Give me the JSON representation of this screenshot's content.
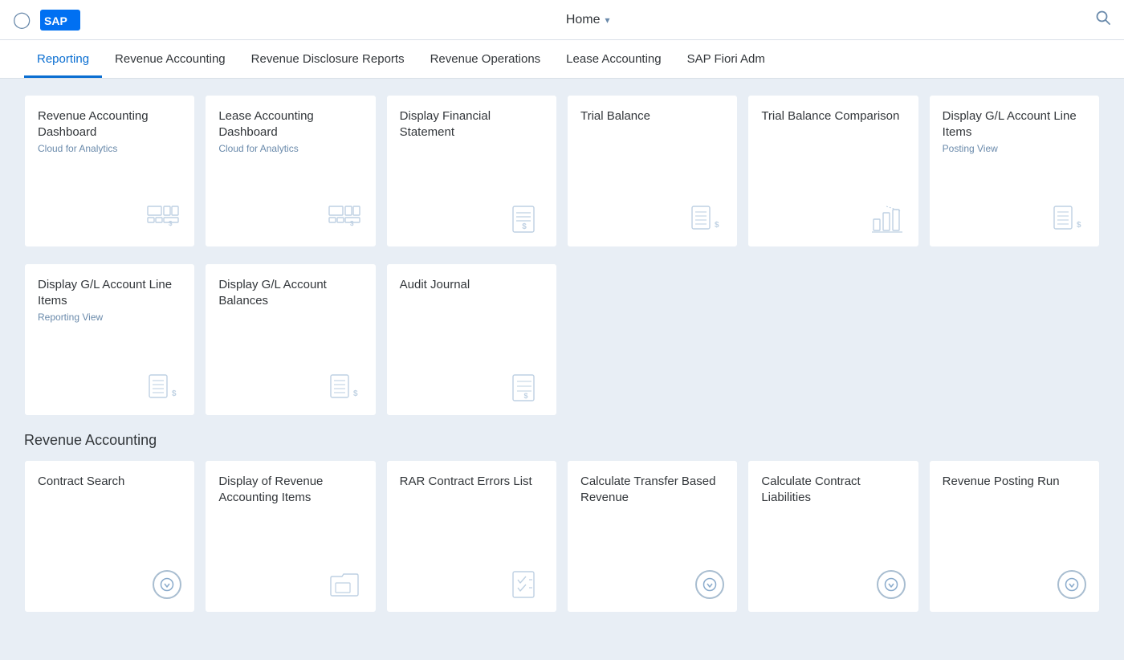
{
  "header": {
    "home_label": "Home",
    "user_icon": "👤",
    "search_icon": "🔍"
  },
  "nav": {
    "items": [
      {
        "label": "Reporting",
        "active": true
      },
      {
        "label": "Revenue Accounting",
        "active": false
      },
      {
        "label": "Revenue Disclosure Reports",
        "active": false
      },
      {
        "label": "Revenue Operations",
        "active": false
      },
      {
        "label": "Lease Accounting",
        "active": false
      },
      {
        "label": "SAP Fiori Adm",
        "active": false
      }
    ]
  },
  "section1": {
    "cards": [
      {
        "title": "Revenue Accounting Dashboard",
        "subtitle": "Cloud for Analytics",
        "icon_type": "analytics"
      },
      {
        "title": "Lease Accounting Dashboard",
        "subtitle": "Cloud for Analytics",
        "icon_type": "analytics"
      },
      {
        "title": "Display Financial Statement",
        "subtitle": "",
        "icon_type": "financial"
      },
      {
        "title": "Trial Balance",
        "subtitle": "",
        "icon_type": "trial_balance"
      },
      {
        "title": "Trial Balance Comparison",
        "subtitle": "",
        "icon_type": "chart"
      },
      {
        "title": "Display G/L Account Line Items",
        "subtitle": "Posting View",
        "icon_type": "gl_items"
      }
    ]
  },
  "section2": {
    "cards": [
      {
        "title": "Display G/L Account Line Items",
        "subtitle": "Reporting View",
        "icon_type": "gl_items"
      },
      {
        "title": "Display G/L Account Balances",
        "subtitle": "",
        "icon_type": "gl_items"
      },
      {
        "title": "Audit Journal",
        "subtitle": "",
        "icon_type": "audit"
      }
    ]
  },
  "section3_label": "Revenue Accounting",
  "section3": {
    "cards": [
      {
        "title": "Contract Search",
        "subtitle": "",
        "icon_type": "circle_down"
      },
      {
        "title": "Display of Revenue Accounting Items",
        "subtitle": "",
        "icon_type": "folder"
      },
      {
        "title": "RAR Contract Errors List",
        "subtitle": "",
        "icon_type": "checklist"
      },
      {
        "title": "Calculate Transfer Based Revenue",
        "subtitle": "",
        "icon_type": "circle_down"
      },
      {
        "title": "Calculate Contract Liabilities",
        "subtitle": "",
        "icon_type": "circle_down"
      },
      {
        "title": "Revenue Posting Run",
        "subtitle": "",
        "icon_type": "circle_down"
      }
    ]
  }
}
